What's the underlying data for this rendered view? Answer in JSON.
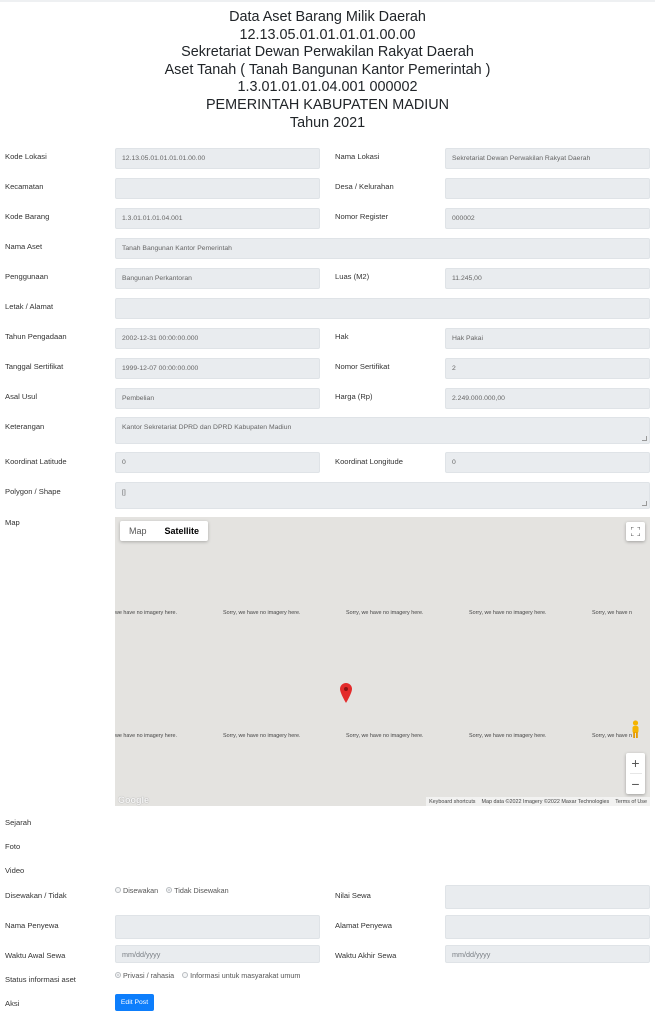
{
  "header": {
    "lines": [
      "Data Aset Barang Milik Daerah",
      "12.13.05.01.01.01.01.00.00",
      "Sekretariat Dewan Perwakilan Rakyat Daerah",
      "Aset Tanah ( Tanah Bangunan Kantor Pemerintah )",
      "1.3.01.01.01.04.001 000002",
      "PEMERINTAH KABUPATEN MADIUN",
      "Tahun 2021"
    ]
  },
  "form": {
    "kode_lokasi": {
      "label": "Kode Lokasi",
      "value": "12.13.05.01.01.01.01.00.00"
    },
    "nama_lokasi": {
      "label": "Nama Lokasi",
      "value": "Sekretariat Dewan Perwakilan Rakyat Daerah"
    },
    "kecamatan": {
      "label": "Kecamatan",
      "value": ""
    },
    "desa": {
      "label": "Desa / Kelurahan",
      "value": ""
    },
    "kode_barang": {
      "label": "Kode Barang",
      "value": "1.3.01.01.01.04.001"
    },
    "nomor_register": {
      "label": "Nomor Register",
      "value": "000002"
    },
    "nama_aset": {
      "label": "Nama Aset",
      "value": "Tanah Bangunan Kantor Pemerintah"
    },
    "penggunaan": {
      "label": "Penggunaan",
      "value": "Bangunan Perkantoran"
    },
    "luas": {
      "label": "Luas (M2)",
      "value": "11.245,00"
    },
    "letak": {
      "label": "Letak / Alamat",
      "value": ""
    },
    "tahun_pengadaan": {
      "label": "Tahun Pengadaan",
      "value": "2002-12-31 00:00:00.000"
    },
    "hak": {
      "label": "Hak",
      "value": "Hak Pakai"
    },
    "tanggal_sertifikat": {
      "label": "Tanggal Sertifikat",
      "value": "1999-12-07 00:00:00.000"
    },
    "nomor_sertifikat": {
      "label": "Nomor Sertifikat",
      "value": "2"
    },
    "asal_usul": {
      "label": "Asal Usul",
      "value": "Pembelian"
    },
    "harga": {
      "label": "Harga (Rp)",
      "value": "2.249.000.000,00"
    },
    "keterangan": {
      "label": "Keterangan",
      "value": "Kantor Sekretariat DPRD dan DPRD Kabupaten Madiun"
    },
    "latitude": {
      "label": "Koordinat Latitude",
      "value": "0"
    },
    "longitude": {
      "label": "Koordinat Longitude",
      "value": "0"
    },
    "polygon": {
      "label": "Polygon / Shape",
      "value": "[]"
    },
    "map_label": "Map",
    "sejarah_label": "Sejarah",
    "foto_label": "Foto",
    "video_label": "Video",
    "disewakan": {
      "label": "Disewakan / Tidak",
      "options": [
        "Disewakan",
        "Tidak Disewakan"
      ],
      "selected": "Tidak Disewakan"
    },
    "nilai_sewa": {
      "label": "Nilai Sewa",
      "value": ""
    },
    "nama_penyewa": {
      "label": "Nama Penyewa",
      "value": ""
    },
    "alamat_penyewa": {
      "label": "Alamat Penyewa",
      "value": ""
    },
    "waktu_awal": {
      "label": "Waktu Awal Sewa",
      "placeholder": "mm/dd/yyyy"
    },
    "waktu_akhir": {
      "label": "Waktu Akhir Sewa",
      "placeholder": "mm/dd/yyyy"
    },
    "status_info": {
      "label": "Status informasi aset",
      "options": [
        "Privasi / rahasia",
        "Informasi untuk masyarakat umum"
      ],
      "selected": "Privasi / rahasia"
    },
    "aksi_label": "Aksi",
    "edit_button": "Edit Post"
  },
  "map": {
    "tab_map": "Map",
    "tab_satellite": "Satellite",
    "active_tab": "Satellite",
    "no_imagery": "Sorry, we have no imagery here.",
    "no_imagery_partial_left": "we have no imagery here.",
    "no_imagery_partial_right": "Sorry, we have n",
    "zoom_in": "+",
    "zoom_out": "−",
    "google_logo": "Google",
    "attribution": {
      "shortcuts": "Keyboard shortcuts",
      "data": "Map data ©2022 Imagery ©2022 Maxar Technologies",
      "terms": "Terms of Use"
    },
    "icons": [
      "fullscreen-icon",
      "pegman-icon",
      "map-marker-icon"
    ],
    "marker_color": "#e32b2b"
  },
  "colors": {
    "primary_button": "#0d7efc",
    "field_bg": "#e9ecef"
  }
}
